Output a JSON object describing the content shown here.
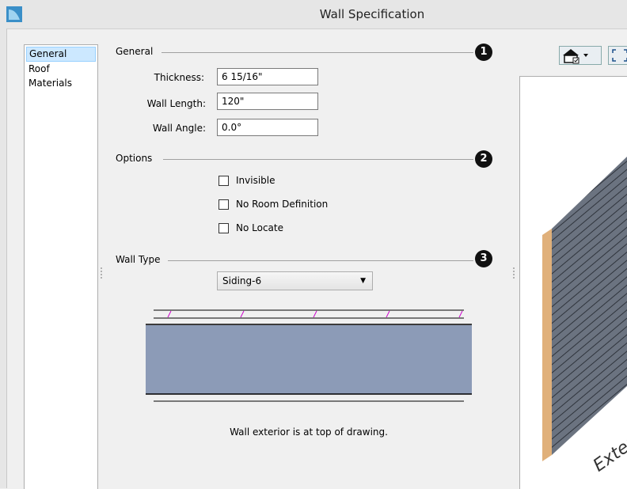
{
  "window": {
    "title": "Wall Specification"
  },
  "sidebar": {
    "items": [
      {
        "label": "General"
      },
      {
        "label": "Roof"
      },
      {
        "label": "Materials"
      }
    ]
  },
  "general": {
    "heading": "General",
    "badge": "1",
    "thickness": {
      "label": "Thickness:",
      "value": "6 15/16\""
    },
    "wall_length": {
      "label": "Wall Length:",
      "value": "120\""
    },
    "wall_angle": {
      "label": "Wall Angle:",
      "value": "0.0°"
    }
  },
  "options": {
    "heading": "Options",
    "badge": "2",
    "invisible": {
      "label": "Invisible",
      "checked": false
    },
    "no_room_definition": {
      "label": "No Room Definition",
      "checked": false
    },
    "no_locate": {
      "label": "No Locate",
      "checked": false
    }
  },
  "wall_type": {
    "heading": "Wall Type",
    "badge": "3",
    "selected": "Siding-6",
    "caption": "Wall exterior is at top of drawing.",
    "layer_color": "#8c9bb7",
    "hatch_color": "#cc00cc"
  },
  "preview": {
    "label": "Exterior",
    "wall_color": "#5c6470",
    "edge_color": "#e0b07a"
  },
  "toolbar": {
    "view_icon": "house-view-icon",
    "fit_icon": "fit-to-window-icon"
  }
}
